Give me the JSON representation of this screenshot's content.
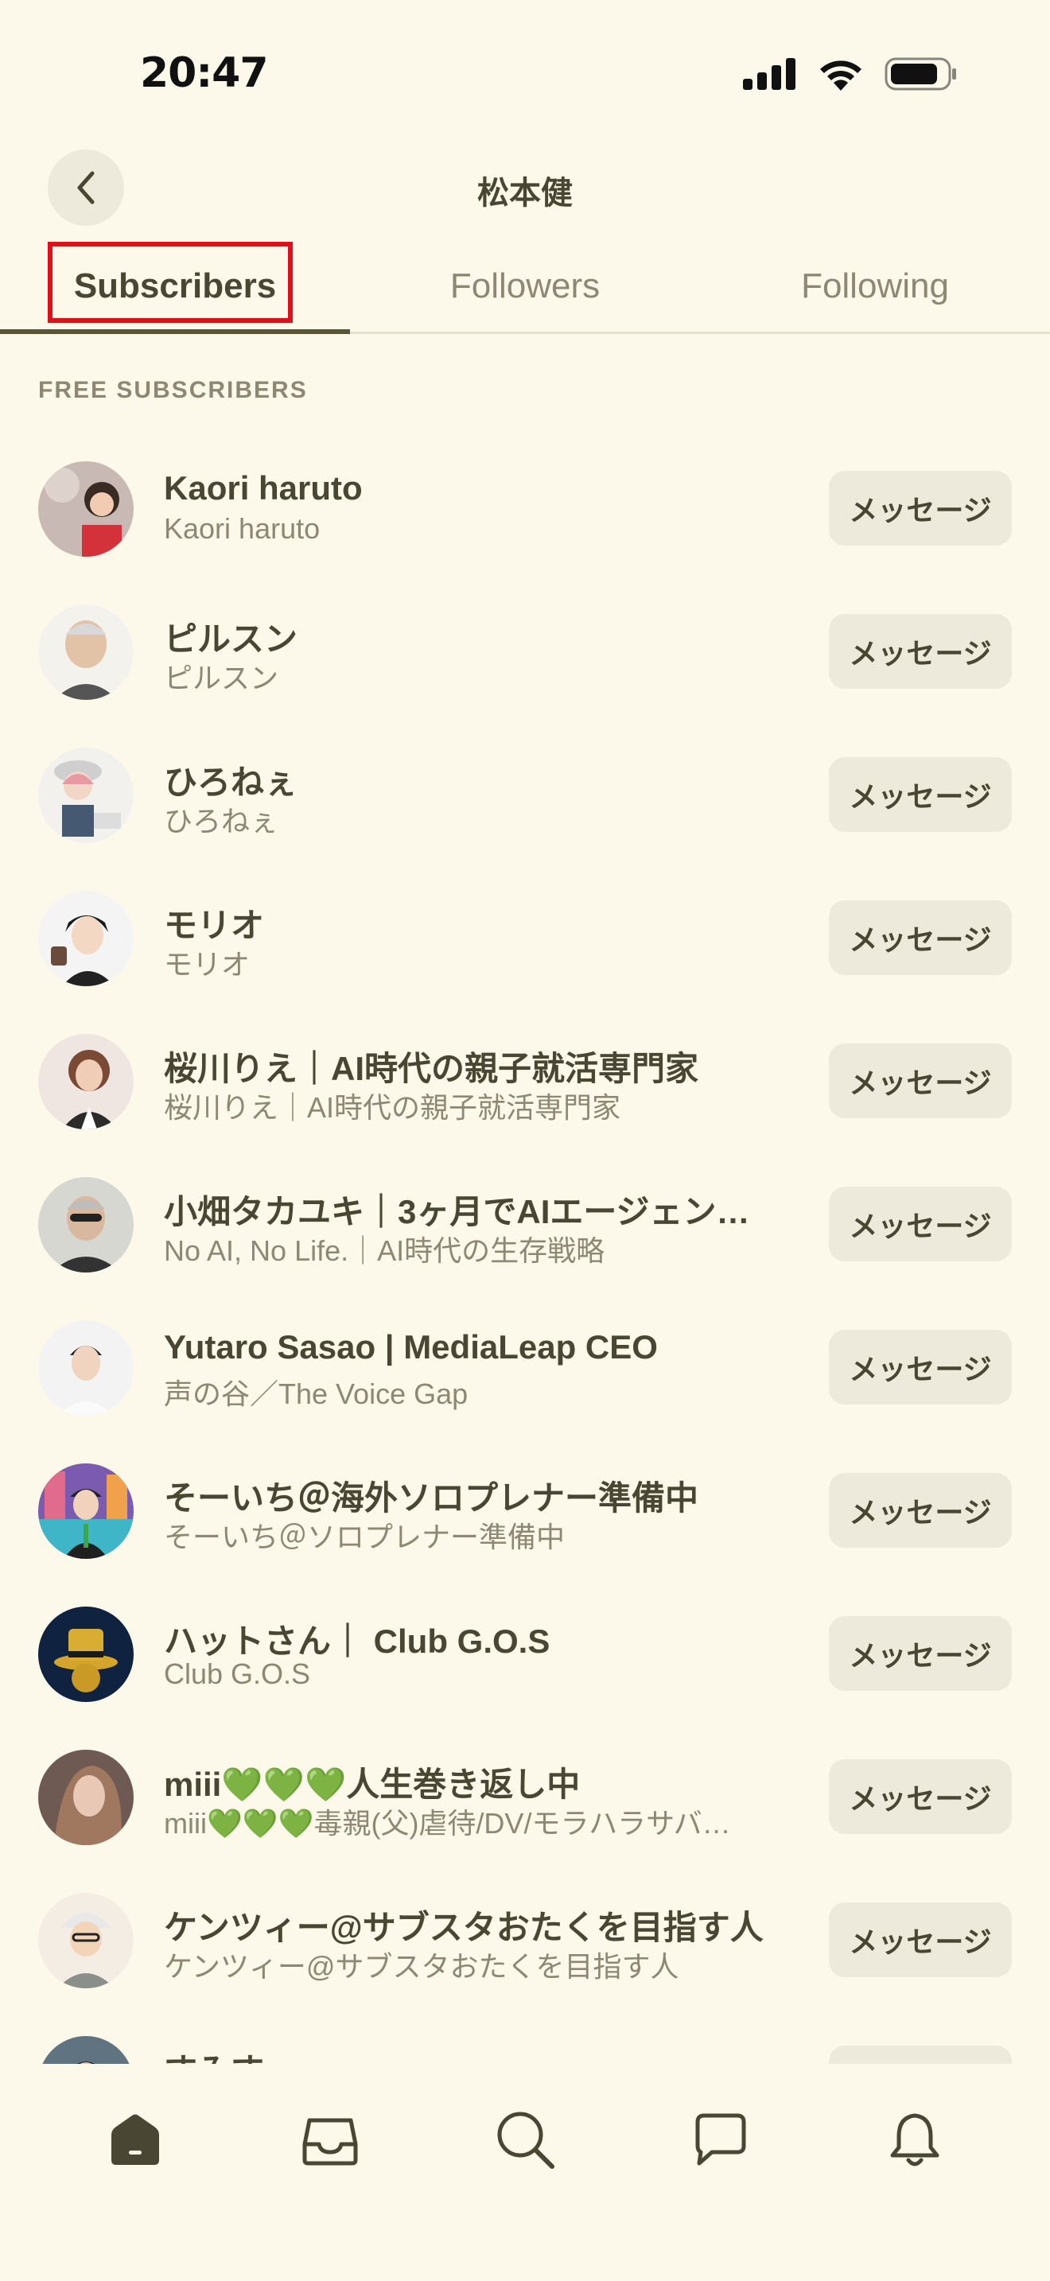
{
  "status_bar": {
    "time": "20:47"
  },
  "header": {
    "title": "松本健"
  },
  "tabs": [
    {
      "label": "Subscribers",
      "active": true
    },
    {
      "label": "Followers",
      "active": false
    },
    {
      "label": "Following",
      "active": false
    }
  ],
  "section_label": "FREE SUBSCRIBERS",
  "message_label": "メッセージ",
  "rows": [
    {
      "name": "Kaori haruto",
      "sub": "Kaori haruto"
    },
    {
      "name": "ピルスン",
      "sub": "ピルスン"
    },
    {
      "name": "ひろねぇ",
      "sub": "ひろねぇ"
    },
    {
      "name": "モリオ",
      "sub": "モリオ"
    },
    {
      "name": "桜川りえ｜AI時代の親子就活専門家",
      "sub": "桜川りえ｜AI時代の親子就活専門家"
    },
    {
      "name": "小畑タカユキ｜3ヶ月でAIエージェン…",
      "sub": "No AI, No Life.｜AI時代の生存戦略"
    },
    {
      "name": "Yutaro Sasao | MediaLeap CEO",
      "sub": "声の谷／The Voice Gap"
    },
    {
      "name": "そーいち＠海外ソロプレナー準備中",
      "sub": "そーいち＠ソロプレナー準備中"
    },
    {
      "name": "ハットさん｜ Club G.O.S",
      "sub": "Club G.O.S"
    },
    {
      "name": "miii💚💚💚人生巻き返し中",
      "sub": "miii💚💚💚毒親(父)虐待/DV/モラハラサバ…"
    },
    {
      "name": "ケンツィー@サブスタおたくを目指す人",
      "sub": "ケンツィー@サブスタおたくを目指す人"
    },
    {
      "name": "すみす",
      "sub": ""
    }
  ],
  "icons": {
    "back": "chevron-left-icon",
    "nav": [
      "home-icon",
      "inbox-icon",
      "search-icon",
      "chat-icon",
      "bell-icon"
    ]
  },
  "colors": {
    "background": "#fdf9ea",
    "text": "#4a4634",
    "muted": "#8c8873",
    "button": "#eeeadb",
    "highlight": "#e0101a"
  }
}
